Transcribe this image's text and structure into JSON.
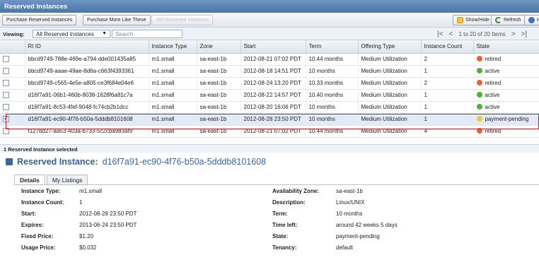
{
  "window": {
    "title": "Reserved Instances"
  },
  "toolbar": {
    "purchase_label": "Purchase Reserved Instances",
    "purchase_more_label": "Purchase More Like These",
    "sell_label": "Sell Reserved Instances",
    "show_hide_label": "Show/Hide",
    "refresh_label": "Refresh",
    "help_label": "He"
  },
  "view": {
    "label": "Viewing:",
    "selected": "All Reserved Instances",
    "search_placeholder": "Search",
    "pagination": "1 to 20 of 20 Items"
  },
  "table": {
    "columns": [
      "RI ID",
      "Instance Type",
      "Zone",
      "Start",
      "Term",
      "Offering Type",
      "Instance Count",
      "State"
    ],
    "rows": [
      {
        "id": "bbcd9749-788e-469e-a794-dde001435a85",
        "type": "m1.small",
        "zone": "sa-east-1b",
        "start": "2012-08-21 07:02 PDT",
        "term": "10.44 months",
        "offering": "Medium Utilization",
        "count": "2",
        "state": "retired",
        "state_color": "#e8622a",
        "checked": false
      },
      {
        "id": "bbcd9749-aaae-49ae-8d6a-c663f4393361",
        "type": "m1.small",
        "zone": "sa-east-1b",
        "start": "2012-08-18 14:51 PDT",
        "term": "10 months",
        "offering": "Medium Utilization",
        "count": "1",
        "state": "active",
        "state_color": "#4cb33a",
        "checked": false
      },
      {
        "id": "bbcd9749-c565-4e5e-a805-ce3f684e04e6",
        "type": "m1.small",
        "zone": "sa-east-1b",
        "start": "2012-08-24 13:20 PDT",
        "term": "10.33 months",
        "offering": "Medium Utilization",
        "count": "2",
        "state": "retired",
        "state_color": "#e8622a",
        "checked": false
      },
      {
        "id": "d16f7a91-06b1-460b-8038-1628f6a81c7a",
        "type": "m1.small",
        "zone": "sa-east-1b",
        "start": "2012-08-22 14:57 PDT",
        "term": "10.40 months",
        "offering": "Medium Utilization",
        "count": "1",
        "state": "active",
        "state_color": "#4cb33a",
        "checked": false
      },
      {
        "id": "d16f7a91-8c53-4fef-9048-fc74cb2b1dcc",
        "type": "m1.small",
        "zone": "sa-east-1b",
        "start": "2012-08-20 16:06 PDT",
        "term": "10 months",
        "offering": "Medium Utilization",
        "count": "1",
        "state": "active",
        "state_color": "#4cb33a",
        "checked": false
      },
      {
        "id": "d16f7a91-ec90-4f76-b50a-5dddb8101608",
        "type": "m1.small",
        "zone": "sa-east-1b",
        "start": "2012-08-28 23:50 PDT",
        "term": "10 months",
        "offering": "Medium Utilization",
        "count": "1",
        "state": "payment-pending",
        "state_color": "#f0c53a",
        "checked": true
      },
      {
        "id": "f127bd27-aa53-403a-b733-5c2cba983af9",
        "type": "m1.small",
        "zone": "sa-east-1b",
        "start": "2012-08-21 07:02 PDT",
        "term": "10.44 months",
        "offering": "Medium Utilization",
        "count": "4",
        "state": "retired",
        "state_color": "#e8622a",
        "checked": false
      }
    ]
  },
  "status": {
    "selection_text": "1 Reserved Instance selected"
  },
  "detail": {
    "heading": "Reserved Instance:",
    "instance_id": "d16f7a91-ec90-4f76-b50a-5dddb8101608",
    "tabs": [
      "Details",
      "My Listings"
    ],
    "left": [
      {
        "key": "Instance Type:",
        "value": "m1.small"
      },
      {
        "key": "Instance Count:",
        "value": "1"
      },
      {
        "key": "Start:",
        "value": "2012-08-28 23:50 PDT"
      },
      {
        "key": "Expires:",
        "value": "2013-06-24 23:50 PDT"
      },
      {
        "key": "Fixed Price:",
        "value": "$1.20"
      },
      {
        "key": "Usage Price:",
        "value": "$0.032"
      }
    ],
    "right": [
      {
        "key": "Availability Zone:",
        "value": "sa-east-1b"
      },
      {
        "key": "Description:",
        "value": "Linux/UNIX"
      },
      {
        "key": "Term:",
        "value": "10 months"
      },
      {
        "key": "Time left:",
        "value": "around 42 weeks 5 days"
      },
      {
        "key": "State:",
        "value": "payment-pending"
      },
      {
        "key": "Tenancy:",
        "value": "default"
      }
    ]
  }
}
